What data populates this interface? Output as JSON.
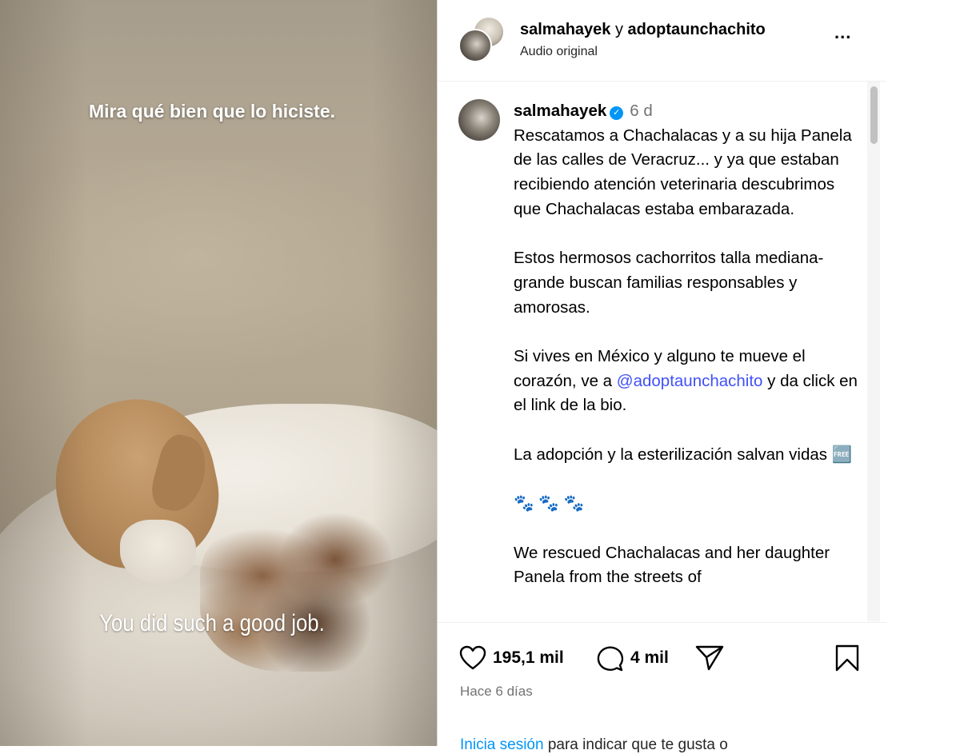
{
  "video": {
    "caption_top": "Mira qué bien que lo hiciste.",
    "caption_bottom": "You did such a good job."
  },
  "header": {
    "user1": "salmahayek",
    "conjunction": "y",
    "user2": "adoptaunchachito",
    "audio": "Audio original",
    "more_label": "..."
  },
  "post": {
    "username": "salmahayek",
    "verified_icon": "✓",
    "age": "6 d",
    "p1": "Rescatamos a Chachalacas y a su hija Panela de las calles de Veracruz... y ya que estaban recibiendo atención veterinaria descubrimos que Chachalacas estaba embarazada.",
    "p2": "Estos hermosos cachorritos talla mediana-grande buscan familias responsables y amorosas.",
    "p3_before": "Si vives en México y alguno te mueve el corazón, ve a",
    "p3_mention": "@adoptaunchachito",
    "p3_after": "y da click en el link de la bio.",
    "p4": "La adopción y la esterilización salvan vidas 🆓",
    "p5": "🐾 🐾 🐾",
    "p6": "We rescued Chachalacas and her daughter Panela from the streets of"
  },
  "actions": {
    "likes": "195,1 mil",
    "comments": "4 mil",
    "when": "Hace 6 días",
    "login_link": "Inicia sesión",
    "login_rest": "para indicar que te gusta o"
  },
  "colors": {
    "link": "#4150f7",
    "verified": "#0095f6",
    "muted": "#737373"
  }
}
